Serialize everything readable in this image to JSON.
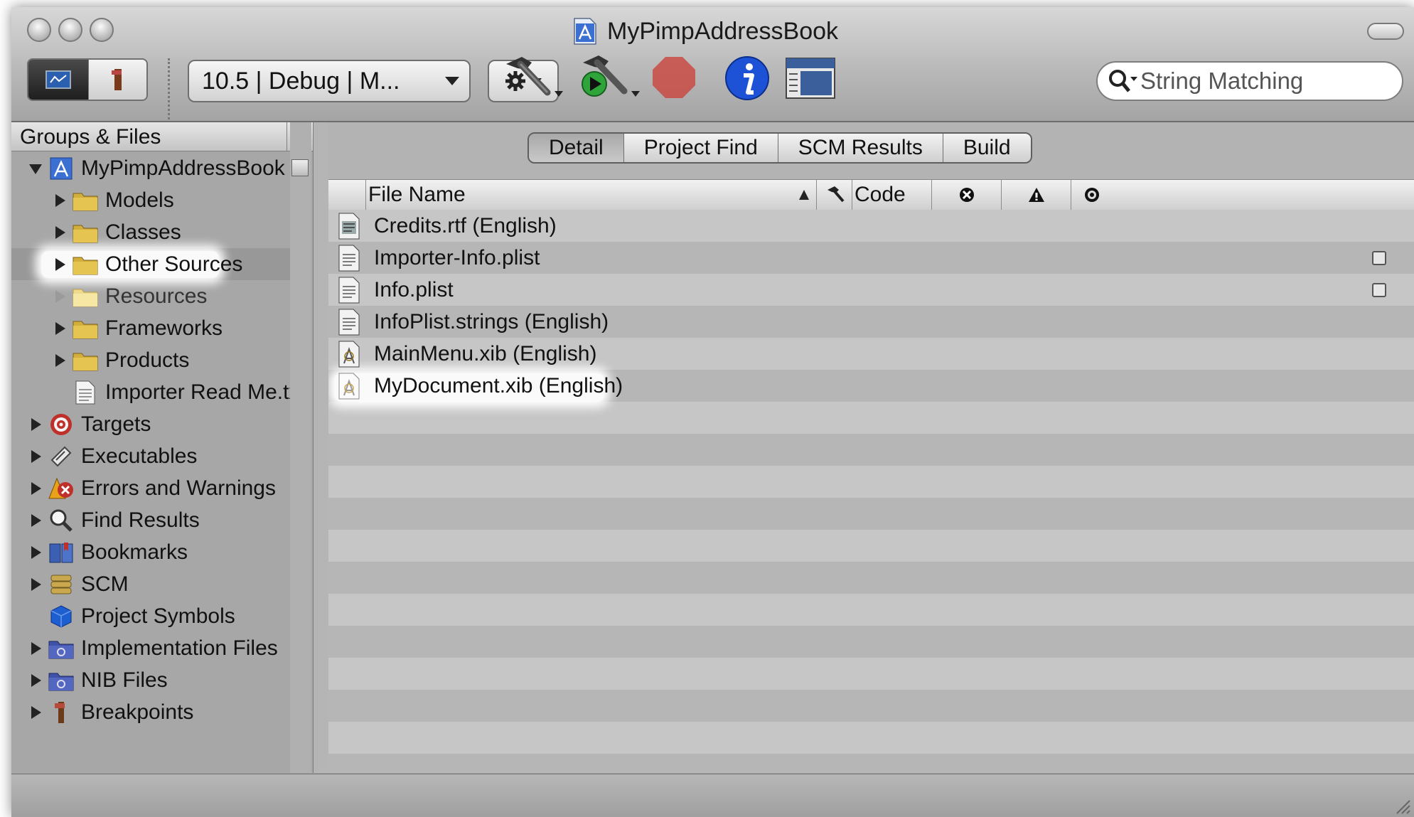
{
  "window": {
    "title": "MyPimpAddressBook"
  },
  "toolbar": {
    "config_popup": "10.5 | Debug | M...",
    "search_placeholder": "String Matching"
  },
  "left_pane": {
    "header": "Groups & Files",
    "project": "MyPimpAddressBook",
    "groups": [
      "Models",
      "Classes",
      "Other Sources",
      "Resources",
      "Frameworks",
      "Products"
    ],
    "file": "Importer Read Me.txt",
    "smart_groups": [
      "Targets",
      "Executables",
      "Errors and Warnings",
      "Find Results",
      "Bookmarks",
      "SCM",
      "Project Symbols",
      "Implementation Files",
      "NIB Files",
      "Breakpoints"
    ]
  },
  "right_pane": {
    "tabs": [
      "Detail",
      "Project Find",
      "SCM Results",
      "Build"
    ],
    "columns": {
      "file_name": "File Name",
      "code": "Code"
    },
    "files": [
      "Credits.rtf (English)",
      "Importer-Info.plist",
      "Info.plist",
      "InfoPlist.strings (English)",
      "MainMenu.xib (English)",
      "MyDocument.xib (English)"
    ]
  }
}
